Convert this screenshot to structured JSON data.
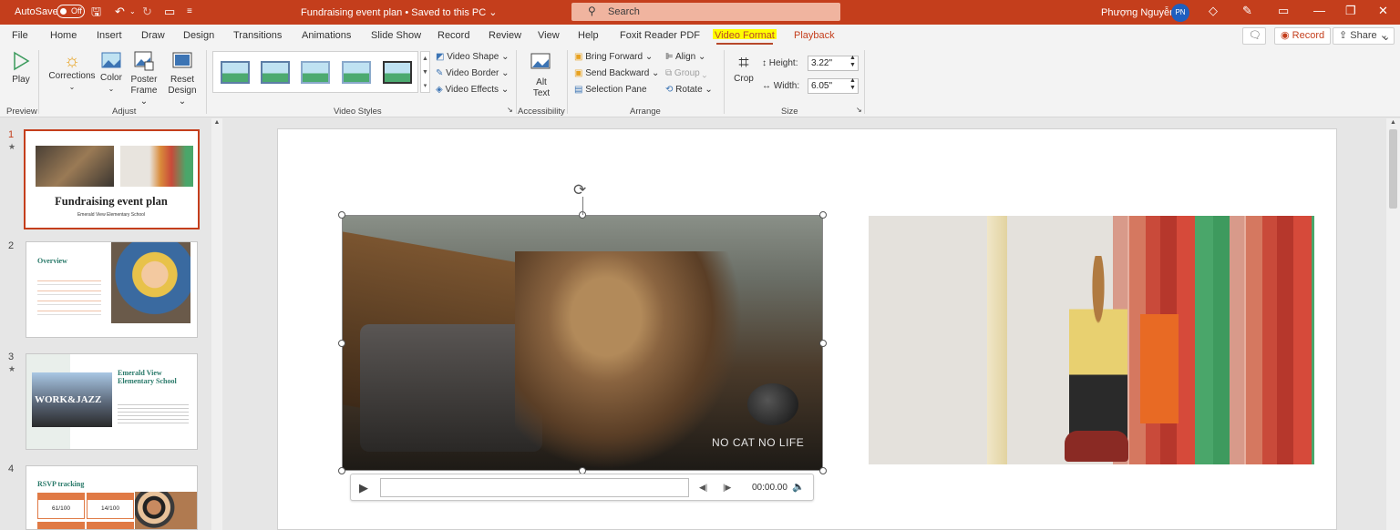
{
  "titlebar": {
    "autosave_label": "AutoSave",
    "autosave_state": "Off",
    "document_title": "Fundraising event plan  •  Saved to this PC ⌄",
    "search_placeholder": "Search",
    "user_name": "Phượng Nguyễn",
    "user_initials": "PN"
  },
  "menu": {
    "tabs": [
      "File",
      "Home",
      "Insert",
      "Draw",
      "Design",
      "Transitions",
      "Animations",
      "Slide Show",
      "Record",
      "Review",
      "View",
      "Help",
      "Foxit Reader PDF",
      "Video Format",
      "Playback"
    ],
    "active_tab": "Video Format",
    "record_button": "Record",
    "share_button": "Share"
  },
  "ribbon": {
    "preview": {
      "play": "Play",
      "label": "Preview"
    },
    "adjust": {
      "corrections": "Corrections",
      "color": "Color",
      "poster": "Poster",
      "poster2": "Frame",
      "reset": "Reset",
      "reset2": "Design",
      "label": "Adjust"
    },
    "video_styles": {
      "shape": "Video Shape",
      "border": "Video Border",
      "effects": "Video Effects",
      "label": "Video Styles"
    },
    "accessibility": {
      "alt": "Alt",
      "alt2": "Text",
      "label": "Accessibility"
    },
    "arrange": {
      "bring_forward": "Bring Forward",
      "send_backward": "Send Backward",
      "selection_pane": "Selection Pane",
      "align": "Align",
      "group": "Group",
      "rotate": "Rotate",
      "label": "Arrange"
    },
    "size": {
      "crop": "Crop",
      "height_label": "Height:",
      "height_value": "3.22\"",
      "width_label": "Width:",
      "width_value": "6.05\"",
      "label": "Size"
    }
  },
  "slides": [
    {
      "number": "1",
      "title": "Fundraising event plan",
      "subtitle": "Emerald View Elementary School"
    },
    {
      "number": "2",
      "title": "Overview"
    },
    {
      "number": "3",
      "title": "Emerald View Elementary School",
      "poster_text": "WORK&JAZZ"
    },
    {
      "number": "4",
      "title": "RSVP tracking",
      "cell1": "61/100",
      "cell2": "14/100"
    }
  ],
  "video": {
    "watermark": "NO CAT NO LIFE",
    "time": "00:00.00"
  },
  "colors": {
    "accent": "#c43e1c",
    "highlight": "#ffff00"
  }
}
